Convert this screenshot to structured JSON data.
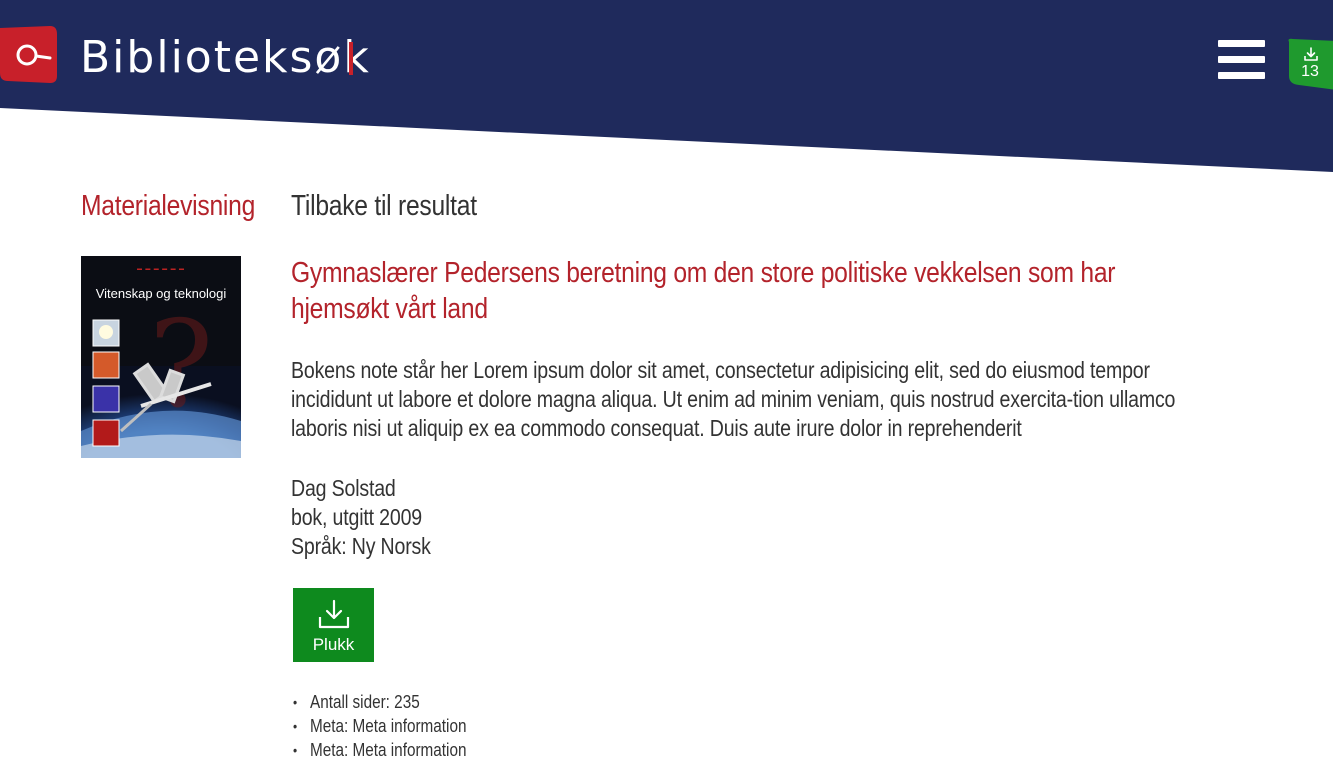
{
  "header": {
    "app_title": "Biblioteksøk",
    "download_count": "13",
    "colors": {
      "header_bg": "#1f2a5c",
      "logo_red": "#c8202a",
      "badge_green": "#1f9a2e"
    }
  },
  "nav": {
    "section_title": "Materialevisning",
    "back_link": "Tilbake til resultat"
  },
  "book": {
    "cover_title": "Vitenskap og teknologi",
    "title": "Gymnaslærer Pedersens beretning om den store politiske vekkelsen som har hjemsøkt vårt land",
    "note": "Bokens note står her Lorem ipsum dolor sit amet, consectetur adipisicing elit, sed do eiusmod tempor incididunt ut labore et dolore magna aliqua. Ut enim ad minim veniam, quis nostrud exercita-tion ullamco laboris nisi ut aliquip ex ea commodo consequat. Duis aute irure dolor in reprehenderit",
    "author": "Dag Solstad",
    "format": "bok, utgitt 2009",
    "language": "Språk: Ny Norsk",
    "pick_label": "Plukk",
    "meta": [
      "Antall sider: 235",
      "Meta: Meta information",
      "Meta: Meta information"
    ]
  },
  "icons": {
    "logo": "search-magnifier-icon",
    "menu": "hamburger-menu-icon",
    "download": "download-icon"
  }
}
